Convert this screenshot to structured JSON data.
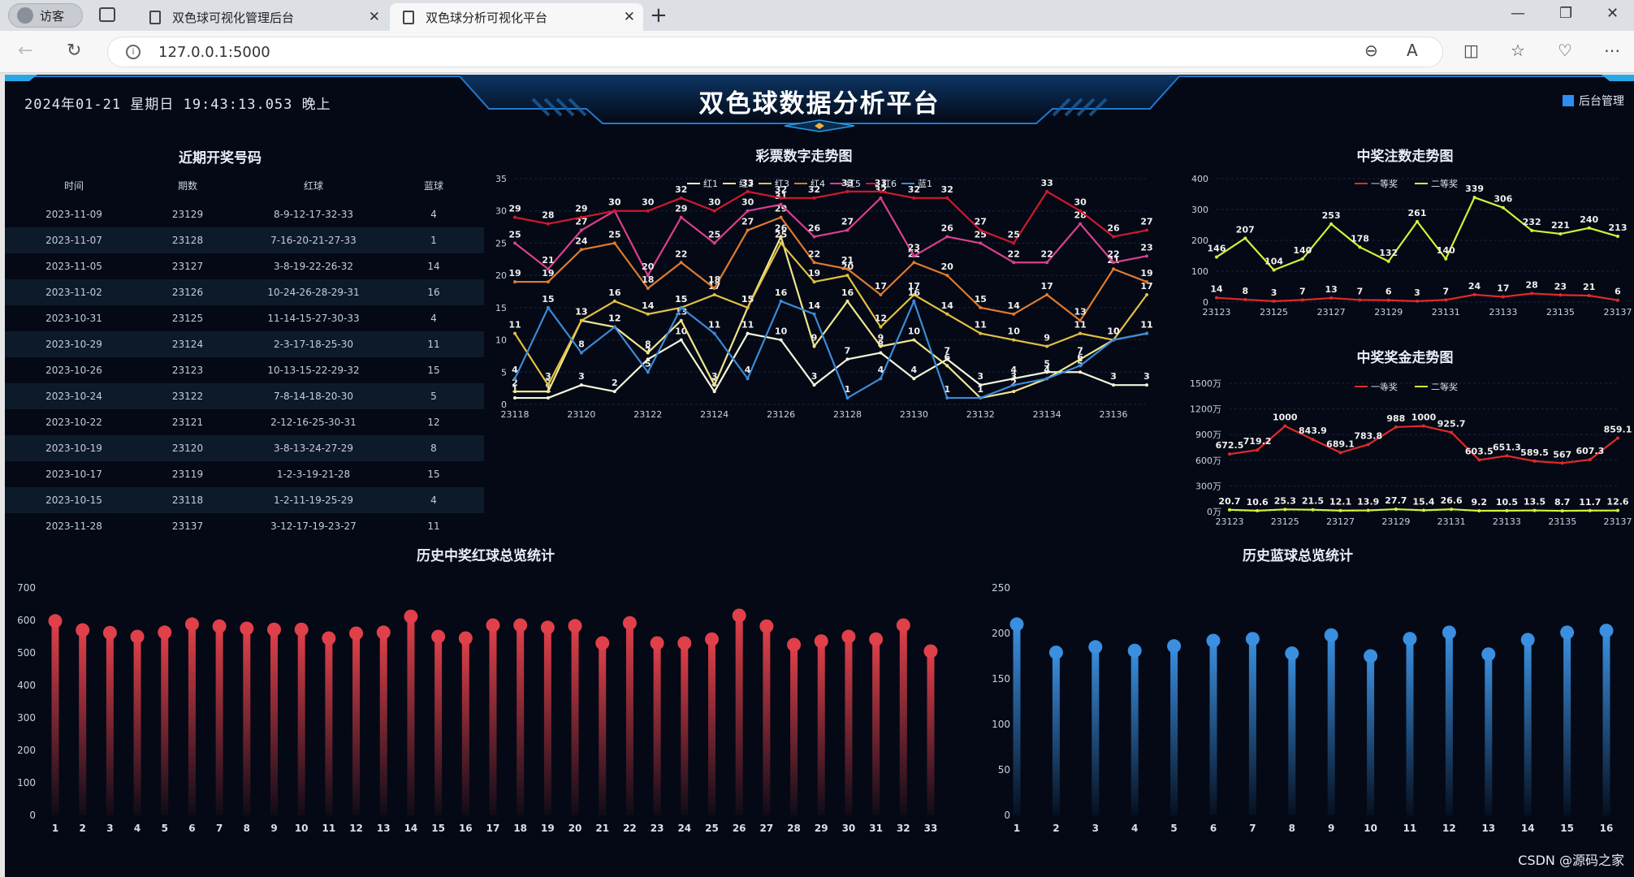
{
  "browser": {
    "guest_label": "访客",
    "tabs": [
      {
        "title": "双色球可视化管理后台"
      },
      {
        "title": "双色球分析可视化平台"
      }
    ],
    "url": "127.0.0.1:5000"
  },
  "dashboard": {
    "datetime": "2024年01-21 星期日 19:43:13.053 晚上",
    "title": "双色球数据分析平台",
    "admin_link": "后台管理",
    "watermark": "CSDN @源码之家"
  },
  "recent_table": {
    "title": "近期开奖号码",
    "columns": [
      "时间",
      "期数",
      "红球",
      "蓝球"
    ],
    "rows": [
      [
        "2023-11-09",
        "23129",
        "8-9-12-17-32-33",
        "4"
      ],
      [
        "2023-11-07",
        "23128",
        "7-16-20-21-27-33",
        "1"
      ],
      [
        "2023-11-05",
        "23127",
        "3-8-19-22-26-32",
        "14"
      ],
      [
        "2023-11-02",
        "23126",
        "10-24-26-28-29-31",
        "16"
      ],
      [
        "2023-10-31",
        "23125",
        "11-14-15-27-30-33",
        "4"
      ],
      [
        "2023-10-29",
        "23124",
        "2-3-17-18-25-30",
        "11"
      ],
      [
        "2023-10-26",
        "23123",
        "10-13-15-22-29-32",
        "15"
      ],
      [
        "2023-10-24",
        "23122",
        "7-8-14-18-20-30",
        "5"
      ],
      [
        "2023-10-22",
        "23121",
        "2-12-16-25-30-31",
        "12"
      ],
      [
        "2023-10-19",
        "23120",
        "3-8-13-24-27-29",
        "8"
      ],
      [
        "2023-10-17",
        "23119",
        "1-2-3-19-21-28",
        "15"
      ],
      [
        "2023-10-15",
        "23118",
        "1-2-11-19-25-29",
        "4"
      ],
      [
        "2023-11-28",
        "23137",
        "3-12-17-19-23-27",
        "11"
      ]
    ]
  },
  "chart_data": [
    {
      "id": "number_trend",
      "type": "line",
      "title": "彩票数字走势图",
      "x": [
        "23118",
        "23119",
        "23120",
        "23121",
        "23122",
        "23123",
        "23124",
        "23125",
        "23126",
        "23127",
        "23128",
        "23129",
        "23130",
        "23131",
        "23132",
        "23133",
        "23134",
        "23135",
        "23136",
        "23137"
      ],
      "x_tick_labels": [
        "23118",
        "23120",
        "23122",
        "23124",
        "23126",
        "23128",
        "23130",
        "23132",
        "23134",
        "23136"
      ],
      "ylim": [
        0,
        35
      ],
      "y_ticks": [
        0,
        5,
        10,
        15,
        20,
        25,
        30,
        35
      ],
      "legend": "top-center",
      "series": [
        {
          "name": "红1",
          "color": "#f5f5dc",
          "values": [
            1,
            1,
            3,
            2,
            7,
            10,
            2,
            11,
            10,
            3,
            7,
            8,
            4,
            7,
            3,
            4,
            5,
            5,
            3,
            3
          ]
        },
        {
          "name": "红2",
          "color": "#f0e68c",
          "values": [
            2,
            2,
            13,
            12,
            8,
            13,
            3,
            15,
            26,
            9,
            16,
            9,
            10,
            6,
            1,
            2,
            4,
            7,
            10,
            11
          ]
        },
        {
          "name": "红3",
          "color": "#e3c042",
          "values": [
            11,
            3,
            13,
            16,
            14,
            15,
            17,
            15,
            25,
            19,
            20,
            12,
            17,
            14,
            11,
            10,
            9,
            11,
            10,
            17
          ]
        },
        {
          "name": "红4",
          "color": "#e07b2c",
          "values": [
            19,
            19,
            24,
            25,
            18,
            22,
            18,
            27,
            29,
            22,
            21,
            17,
            22,
            20,
            15,
            14,
            17,
            13,
            21,
            19
          ]
        },
        {
          "name": "红5",
          "color": "#d9408c",
          "values": [
            25,
            21,
            27,
            30,
            20,
            29,
            25,
            30,
            31,
            26,
            27,
            32,
            23,
            26,
            25,
            22,
            22,
            28,
            22,
            23
          ]
        },
        {
          "name": "红6",
          "color": "#d0182e",
          "values": [
            29,
            28,
            29,
            30,
            30,
            32,
            30,
            33,
            32,
            32,
            33,
            33,
            32,
            32,
            27,
            25,
            33,
            30,
            26,
            27
          ]
        },
        {
          "name": "蓝1",
          "color": "#3c8ad8",
          "values": [
            4,
            15,
            8,
            12,
            5,
            15,
            11,
            4,
            16,
            14,
            1,
            4,
            16,
            1,
            1,
            3,
            4,
            6,
            10,
            11
          ]
        }
      ]
    },
    {
      "id": "winner_count_trend",
      "type": "line",
      "title": "中奖注数走势图",
      "x": [
        "23123",
        "23124",
        "23125",
        "23126",
        "23127",
        "23128",
        "23129",
        "23130",
        "23131",
        "23132",
        "23133",
        "23134",
        "23135",
        "23136",
        "23137"
      ],
      "x_tick_labels": [
        "23123",
        "23125",
        "23127",
        "23129",
        "23131",
        "23133",
        "23135",
        "23137"
      ],
      "ylim": [
        0,
        400
      ],
      "y_ticks": [
        0,
        100,
        200,
        300,
        400
      ],
      "legend": "top-center",
      "series": [
        {
          "name": "一等奖",
          "color": "#e02a2a",
          "values": [
            14,
            8,
            3,
            7,
            13,
            7,
            6,
            3,
            7,
            24,
            17,
            28,
            23,
            21,
            6
          ]
        },
        {
          "name": "二等奖",
          "color": "#d6f03a",
          "values": [
            146,
            207,
            104,
            140,
            253,
            178,
            132,
            261,
            140,
            339,
            306,
            232,
            221,
            240,
            213
          ]
        }
      ]
    },
    {
      "id": "prize_amount_trend",
      "type": "line",
      "title": "中奖奖金走势图",
      "x": [
        "23123",
        "23124",
        "23125",
        "23126",
        "23127",
        "23128",
        "23129",
        "23130",
        "23131",
        "23132",
        "23133",
        "23134",
        "23135",
        "23136",
        "23137"
      ],
      "x_tick_labels": [
        "23123",
        "23125",
        "23127",
        "23129",
        "23131",
        "23133",
        "23135",
        "23137"
      ],
      "ylim": [
        0,
        1500
      ],
      "y_ticks": [
        0,
        300,
        600,
        900,
        1200,
        1500
      ],
      "y_tick_labels": [
        "0万",
        "300万",
        "600万",
        "900万",
        "1200万",
        "1500万"
      ],
      "legend": "top-center",
      "series": [
        {
          "name": "一等奖",
          "color": "#e02a2a",
          "values": [
            672.5,
            719.2,
            1000,
            843.9,
            689.1,
            783.8,
            988,
            1000,
            925.7,
            603.5,
            651.3,
            589.5,
            567,
            607.3,
            859.1
          ]
        },
        {
          "name": "二等奖",
          "color": "#d6f03a",
          "values": [
            20.7,
            10.6,
            25.3,
            21.5,
            12.1,
            13.9,
            27.7,
            15.4,
            26.6,
            9.2,
            10.5,
            13.5,
            8.7,
            11.7,
            12.6
          ]
        }
      ]
    },
    {
      "id": "red_ball_totals",
      "type": "bar",
      "title": "历史中奖红球总览统计",
      "categories": [
        "1",
        "2",
        "3",
        "4",
        "5",
        "6",
        "7",
        "8",
        "9",
        "10",
        "11",
        "12",
        "13",
        "14",
        "15",
        "16",
        "17",
        "18",
        "19",
        "20",
        "21",
        "22",
        "23",
        "24",
        "25",
        "26",
        "27",
        "28",
        "29",
        "30",
        "31",
        "32",
        "33"
      ],
      "values": [
        598,
        570,
        562,
        550,
        563,
        588,
        582,
        575,
        572,
        572,
        545,
        560,
        563,
        612,
        550,
        545,
        585,
        585,
        578,
        583,
        530,
        592,
        530,
        530,
        542,
        615,
        582,
        525,
        536,
        550,
        542,
        585,
        505
      ],
      "ylim": [
        0,
        700
      ],
      "y_ticks": [
        0,
        100,
        200,
        300,
        400,
        500,
        600,
        700
      ],
      "color": "#e0404a"
    },
    {
      "id": "blue_ball_totals",
      "type": "bar",
      "title": "历史蓝球总览统计",
      "categories": [
        "1",
        "2",
        "3",
        "4",
        "5",
        "6",
        "7",
        "8",
        "9",
        "10",
        "11",
        "12",
        "13",
        "14",
        "15",
        "16"
      ],
      "values": [
        210,
        179,
        185,
        181,
        186,
        192,
        194,
        178,
        198,
        175,
        194,
        201,
        177,
        193,
        201,
        203
      ],
      "ylim": [
        0,
        250
      ],
      "y_ticks": [
        0,
        50,
        100,
        150,
        200,
        250
      ],
      "color": "#3a8fe0"
    }
  ]
}
